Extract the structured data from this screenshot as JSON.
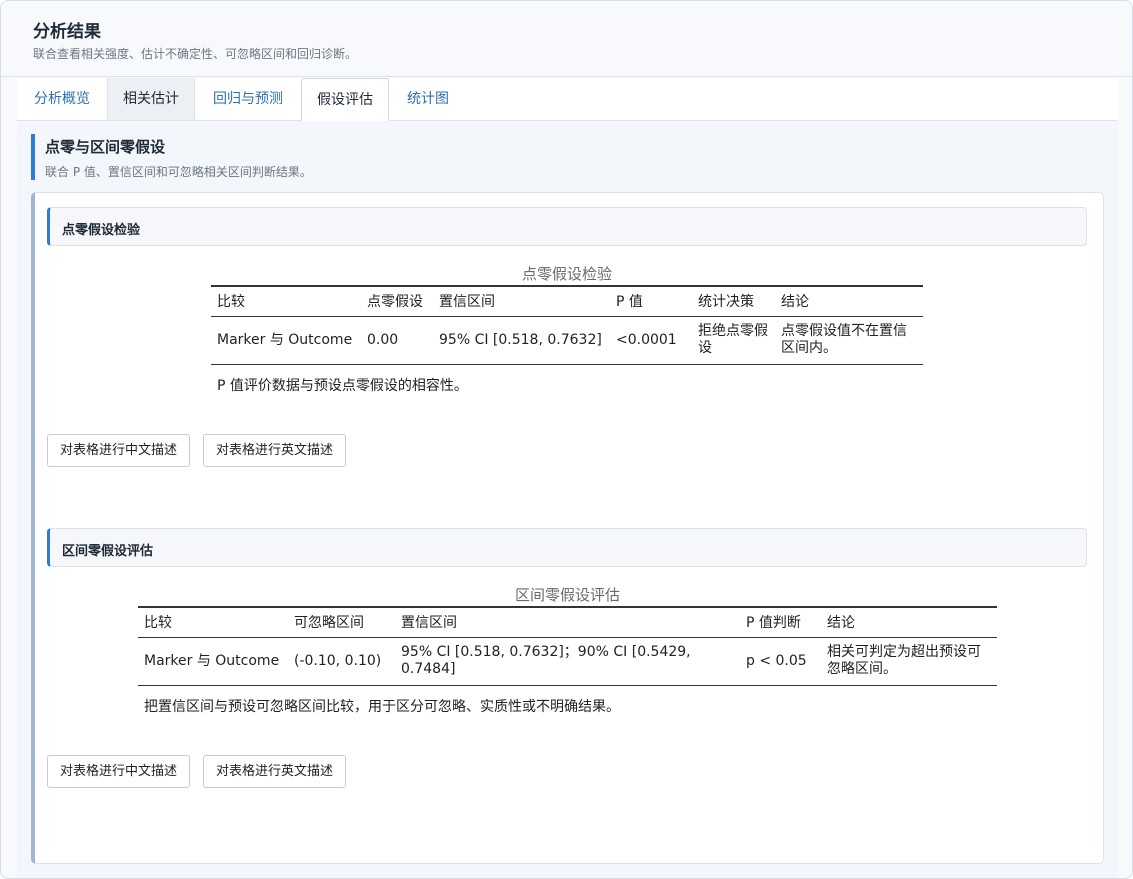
{
  "header": {
    "title": "分析结果",
    "subtitle": "联合查看相关强度、估计不确定性、可忽略区间和回归诊断。"
  },
  "tabs": [
    {
      "label": "分析概览"
    },
    {
      "label": "相关估计"
    },
    {
      "label": "回归与预测"
    },
    {
      "label": "假设评估",
      "active": true
    },
    {
      "label": "统计图"
    }
  ],
  "section": {
    "title": "点零与区间零假设",
    "subtitle": "联合 P 值、置信区间和可忽略相关区间判断结果。"
  },
  "point_null": {
    "card_title": "点零假设检验",
    "table_title": "点零假设检验",
    "columns": [
      "比较",
      "点零假设",
      "置信区间",
      "P 值",
      "统计决策",
      "结论"
    ],
    "rows": [
      [
        "Marker 与 Outcome",
        "0.00",
        "95% CI [0.518, 0.7632]",
        "<0.0001",
        "拒绝点零假设",
        "点零假设值不在置信区间内。"
      ]
    ],
    "note": "P 值评价数据与预设点零假设的相容性。",
    "buttons": {
      "zh": "对表格进行中文描述",
      "en": "对表格进行英文描述"
    }
  },
  "interval_null": {
    "card_title": "区间零假设评估",
    "table_title": "区间零假设评估",
    "columns": [
      "比较",
      "可忽略区间",
      "置信区间",
      "P 值判断",
      "结论"
    ],
    "rows": [
      [
        "Marker 与 Outcome",
        "(-0.10, 0.10)",
        "95% CI [0.518, 0.7632]；90% CI [0.5429, 0.7484]",
        "p < 0.05",
        "相关可判定为超出预设可忽略区间。"
      ]
    ],
    "note": "把置信区间与预设可忽略区间比较，用于区分可忽略、实质性或不明确结果。",
    "buttons": {
      "zh": "对表格进行中文描述",
      "en": "对表格进行英文描述"
    }
  },
  "colors": {
    "accent": "#2f7cd6",
    "link": "#2f6fad"
  }
}
